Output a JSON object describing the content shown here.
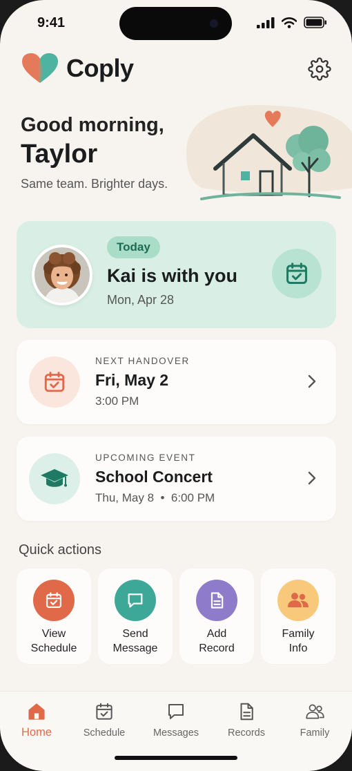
{
  "status_bar": {
    "time": "9:41"
  },
  "header": {
    "app_name": "Coply",
    "logo_icon": "heart-logo-icon",
    "settings_icon": "gear-icon"
  },
  "greeting": {
    "line1": "Good morning,",
    "name": "Taylor",
    "tagline": "Same team. Brighter days."
  },
  "today_card": {
    "badge": "Today",
    "title": "Kai is with you",
    "date": "Mon, Apr 28",
    "icon": "calendar-check-icon"
  },
  "next_handover": {
    "label": "NEXT HANDOVER",
    "title": "Fri, May 2",
    "subtitle": "3:00 PM",
    "icon": "calendar-check-icon"
  },
  "upcoming_event": {
    "label": "UPCOMING EVENT",
    "title": "School Concert",
    "subtitle": "Thu, May 8  •  6:00 PM",
    "icon": "graduation-cap-icon"
  },
  "quick_actions": {
    "title": "Quick actions",
    "items": [
      {
        "label": "View\nSchedule",
        "icon": "calendar-check-icon",
        "color": "#e0694a"
      },
      {
        "label": "Send\nMessage",
        "icon": "message-icon",
        "color": "#3ea898"
      },
      {
        "label": "Add\nRecord",
        "icon": "document-icon",
        "color": "#8e7bc9"
      },
      {
        "label": "Family\nInfo",
        "icon": "people-icon",
        "color": "#f8c97a"
      }
    ]
  },
  "tab_bar": {
    "items": [
      {
        "label": "Home",
        "icon": "home-icon",
        "active": true
      },
      {
        "label": "Schedule",
        "icon": "calendar-icon",
        "active": false
      },
      {
        "label": "Messages",
        "icon": "chat-icon",
        "active": false
      },
      {
        "label": "Records",
        "icon": "document-icon",
        "active": false
      },
      {
        "label": "Family",
        "icon": "people-icon",
        "active": false
      }
    ]
  },
  "colors": {
    "accent": "#e0694a",
    "teal": "#3ea898",
    "mint_card": "#d9efe6",
    "background": "#f7f4ef"
  }
}
